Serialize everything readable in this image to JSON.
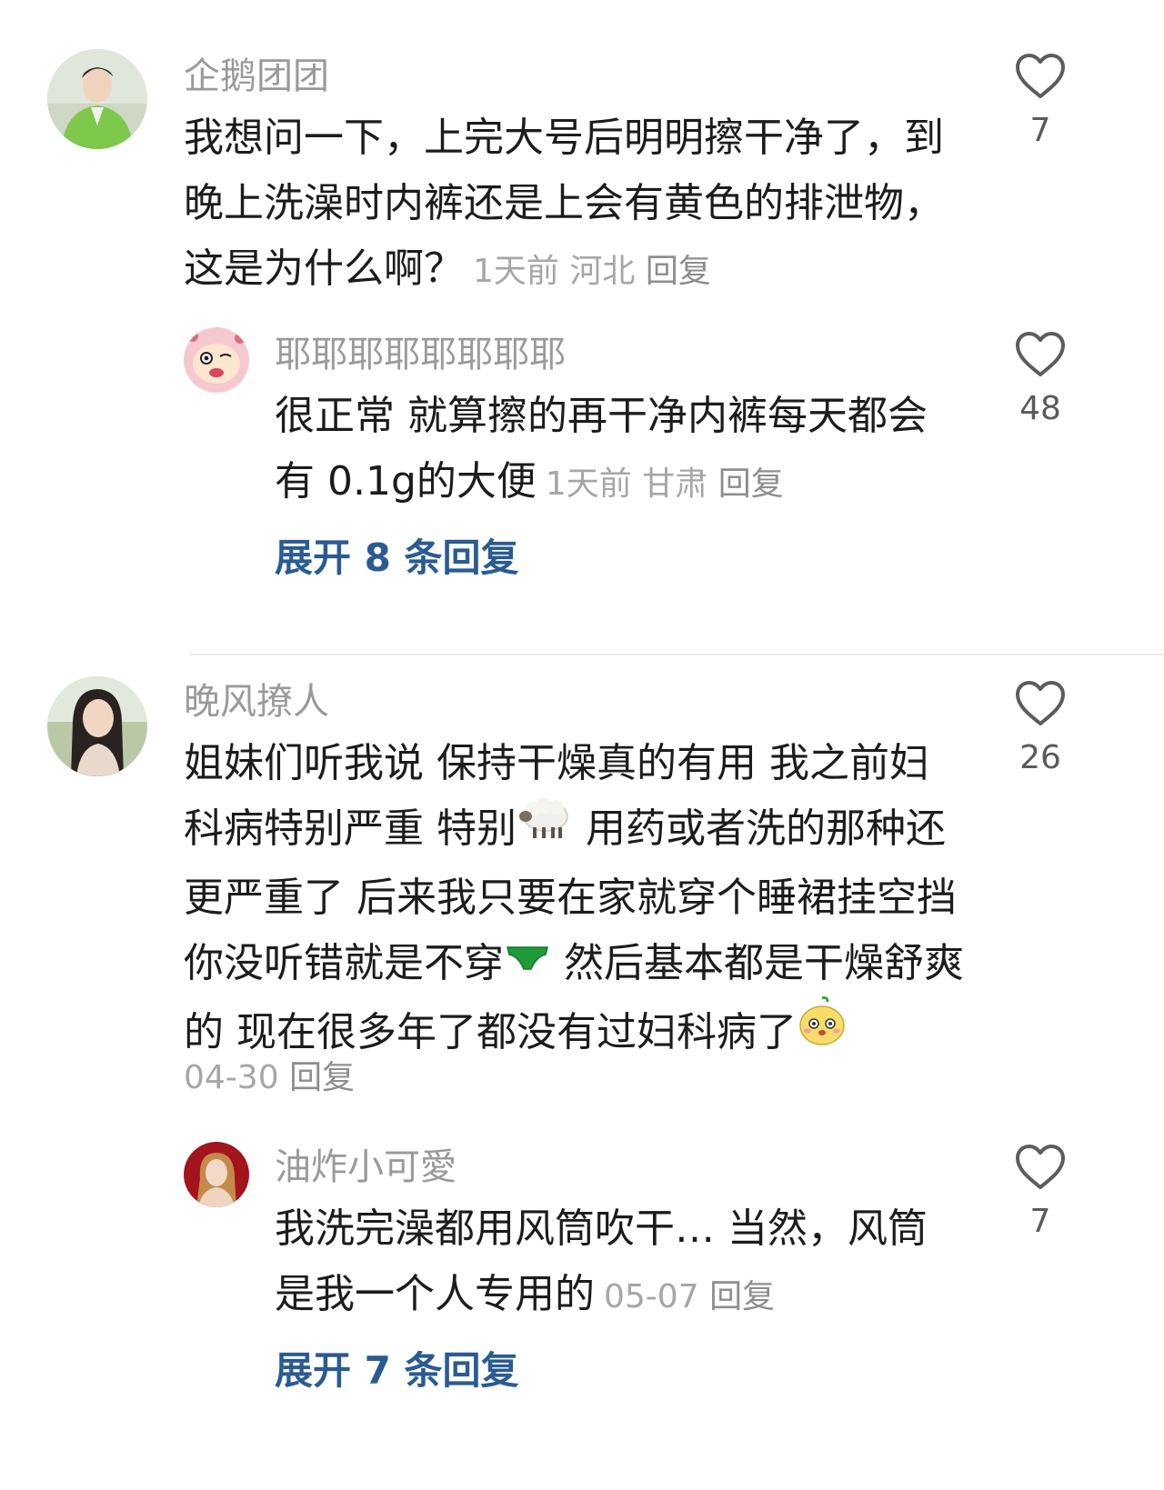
{
  "comments": [
    {
      "username": "企鹅团团",
      "text": "我想问一下，上完大号后明明擦干净了，到晚上洗澡时内裤还是上会有黄色的排泄物，这是为什么啊？",
      "time": "1天前",
      "location": "河北",
      "reply_label": "回复",
      "likes": "7",
      "avatar_icon": "man-green-suit-avatar",
      "reply": {
        "username": "耶耶耶耶耶耶耶耶",
        "text": "很正常 就算擦的再干净内裤每天都会有 0.1g的大便",
        "time": "1天前",
        "location": "甘肃",
        "reply_label": "回复",
        "likes": "48",
        "avatar_icon": "cartoon-character-avatar"
      },
      "expand_label": "展开 8 条回复"
    },
    {
      "username": "晚风撩人",
      "text_part1": "姐妹们听我说 保持干燥真的有用 我之前妇科病特别严重 特别",
      "emoji1": "sheep-emoji",
      "text_part2": " 用药或者洗的那种还更严重了 后来我只要在家就穿个睡裙挂空挡 你没听错就是不穿",
      "emoji2": "green-underwear-emoji",
      "text_part3": " 然后基本都是干燥舒爽的 现在很多年了都没有过妇科病了",
      "emoji3": "cute-face-emoji",
      "time": "04-30",
      "reply_label": "回复",
      "likes": "26",
      "avatar_icon": "woman-outdoor-avatar",
      "reply": {
        "username": "油炸小可愛",
        "text": "我洗完澡都用风筒吹干… 当然，风筒是我一个人专用的",
        "time": "05-07",
        "reply_label": "回复",
        "likes": "7",
        "avatar_icon": "woman-red-background-avatar"
      },
      "expand_label": "展开 7 条回复"
    }
  ],
  "colors": {
    "username": "#9a9a9a",
    "meta": "#a6a6a6",
    "expand_link": "#2a5b93",
    "divider": "#ececec"
  }
}
